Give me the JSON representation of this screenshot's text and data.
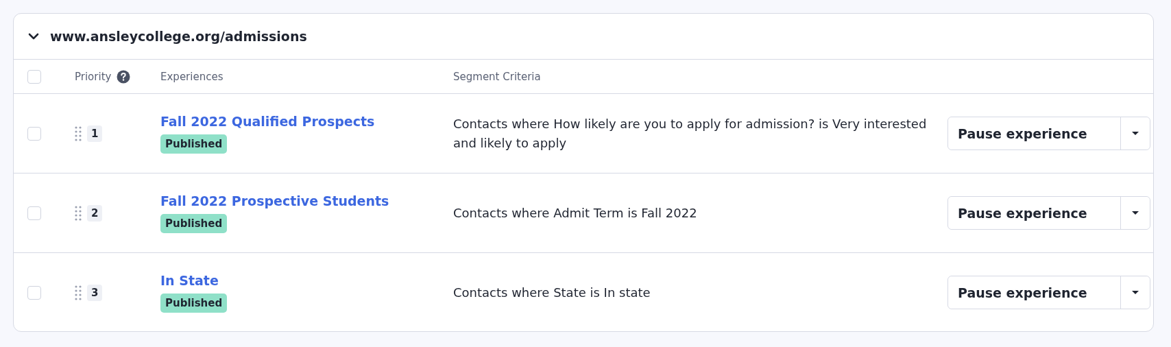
{
  "group": {
    "title": "www.ansleycollege.org/admissions",
    "expanded": true
  },
  "table": {
    "select_all": {
      "checked": false
    },
    "columns": [
      "Priority",
      "Experiences",
      "Segment Criteria"
    ],
    "rows": [
      {
        "checked": false,
        "priority": "1",
        "experience": "Fall 2022 Qualified Prospects",
        "status": "Published",
        "criteria": "Contacts where How likely are you to apply for admission? is Very interested and likely to apply",
        "action": "Pause experience"
      },
      {
        "checked": false,
        "priority": "2",
        "experience": "Fall 2022 Prospective Students",
        "status": "Published",
        "criteria": "Contacts where Admit Term is Fall 2022",
        "action": "Pause experience"
      },
      {
        "checked": false,
        "priority": "3",
        "experience": "In State",
        "status": "Published",
        "criteria": "Contacts where State is In state",
        "action": "Pause experience"
      }
    ]
  }
}
